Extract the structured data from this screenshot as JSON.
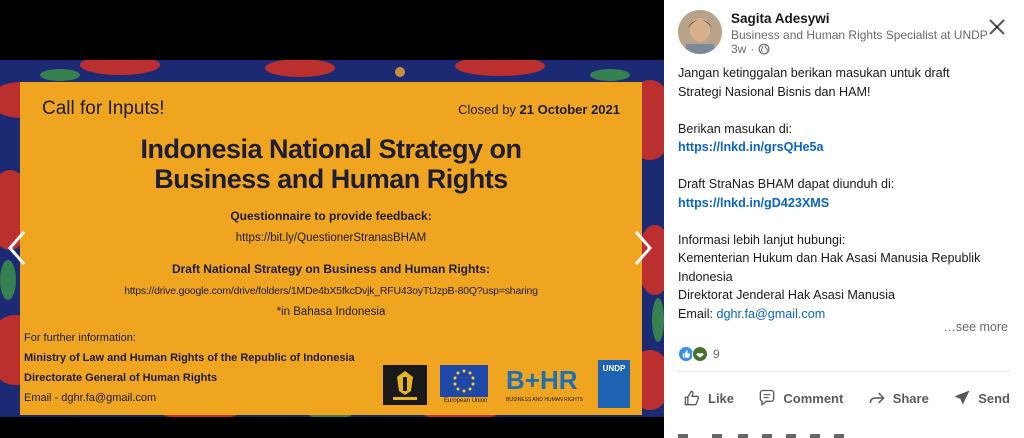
{
  "viewer": {
    "poster": {
      "call_title": "Call for Inputs!",
      "closed_prefix": "Closed by ",
      "closed_date": "21 October 2021",
      "title_line1": "Indonesia National Strategy on",
      "title_line2": "Business and Human Rights",
      "questionnaire_heading": "Questionnaire to provide feedback:",
      "questionnaire_url": "https://bit.ly/QuestionerStranasBHAM",
      "draft_heading": "Draft National Strategy on Business and Human Rights:",
      "draft_url": "https://drive.google.com/drive/folders/1MDe4bX5fkcDvjk_RFU43oyTtJzpB-80Q?usp=sharing",
      "draft_note": "*in Bahasa Indonesia",
      "info_heading": "For further information:",
      "ministry": "Ministry of Law and Human Rights of the Republic of Indonesia",
      "directorate": "Directorate General of Human Rights",
      "email": "Email - dghr.fa@gmail.com",
      "logos": {
        "eu_caption": "European Union",
        "bhr_text": "B+HR",
        "bhr_caption": "BUSINESS AND HUMAN RIGHTS",
        "undp_text": "UNDP"
      }
    }
  },
  "post": {
    "author": "Sagita Adesywi",
    "headline": "Business and Human Rights Specialist at UNDP",
    "time": "3w",
    "globe_icon": "globe-icon",
    "lines": [
      "Jangan ketinggalan berikan masukan untuk draft",
      "Strategi Nasional Bisnis dan HAM!",
      "Berikan masukan di:",
      "https://lnkd.in/grsQHe5a",
      "Draft StraNas BHAM dapat diunduh di:",
      "https://lnkd.in/gD423XMS",
      "Informasi lebih lanjut hubungi:",
      "Kementerian Hukum dan Hak Asasi Manusia Republik",
      "Indonesia",
      "Direktorat Jenderal Hak Asasi Manusia",
      "Email: ",
      "dghr.fa@gmail.com"
    ],
    "see_more": "…see more",
    "reaction_count": "9",
    "actions": {
      "like": "Like",
      "comment": "Comment",
      "share": "Share",
      "send": "Send"
    }
  },
  "colors": {
    "poster_orange": "#f0a521",
    "poster_text": "#1d1d38",
    "link_blue": "#0a66c2",
    "batik_blue": "#1c2a73",
    "batik_red": "#c4302b"
  }
}
